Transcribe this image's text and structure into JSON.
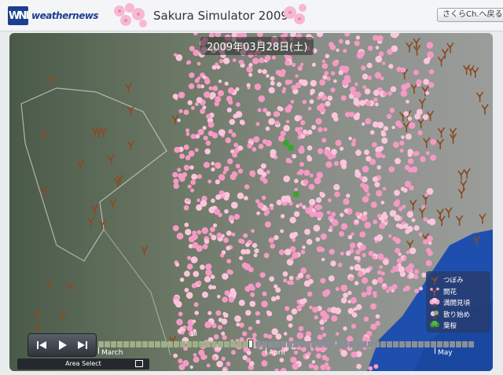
{
  "header": {
    "logo_mark": "WNI",
    "logo_text": "weathernews",
    "title": "Sakura Simulator 2009",
    "back_button": "さくらCh.へ戻る"
  },
  "map": {
    "date": "2009年03月28日(土)",
    "legend": [
      {
        "label": "つぼみ",
        "icon": "bud-icon",
        "color": "#8a4a22"
      },
      {
        "label": "開花",
        "icon": "flowering-icon",
        "color": "#a0522d"
      },
      {
        "label": "満開見頃",
        "icon": "full-bloom-icon",
        "color": "#f7a6c8"
      },
      {
        "label": "散り始め",
        "icon": "falling-petals-icon",
        "color": "#f1c1d6"
      },
      {
        "label": "葉桜",
        "icon": "leaf-cherry-icon",
        "color": "#3a9a2e"
      }
    ]
  },
  "controls": {
    "area_select": "Area Select",
    "day_marker": "18",
    "months": [
      "March",
      "April",
      "May"
    ],
    "progress": 0.4
  },
  "colors": {
    "brand": "#1d3f8f",
    "blossom": "#f59ac4",
    "bud": "#8a4a22",
    "sea": "#1f4fae"
  }
}
